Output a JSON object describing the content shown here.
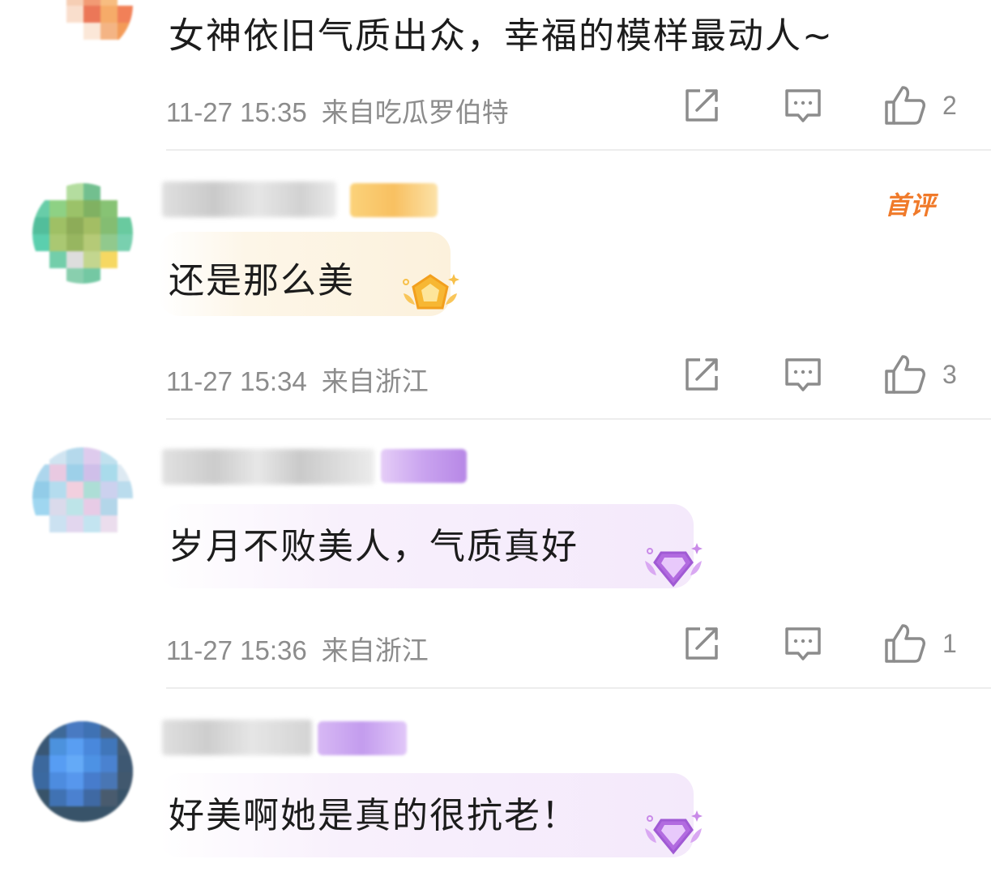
{
  "comments": [
    {
      "text": "女神依旧气质出众，幸福的模样最动人~",
      "time": "11-27 15:35",
      "source": "来自吃瓜罗伯特",
      "likes": "2"
    },
    {
      "text": "还是那么美",
      "time": "11-27 15:34",
      "source": "来自浙江",
      "likes": "3",
      "badge": "首评",
      "bubble_style": "gold"
    },
    {
      "text": "岁月不败美人，气质真好",
      "time": "11-27 15:36",
      "source": "来自浙江",
      "likes": "1",
      "bubble_style": "purple"
    },
    {
      "text": "好美啊她是真的很抗老！",
      "bubble_style": "purple"
    }
  ],
  "icons": {
    "share": "share-icon",
    "reply": "comment-icon",
    "like": "thumbs-up-icon"
  },
  "colors": {
    "meta_gray": "#8c8c8c",
    "first_comment_orange": "#f07a2a",
    "gold_medal": "#f7b733",
    "purple_medal": "#b26be0"
  }
}
